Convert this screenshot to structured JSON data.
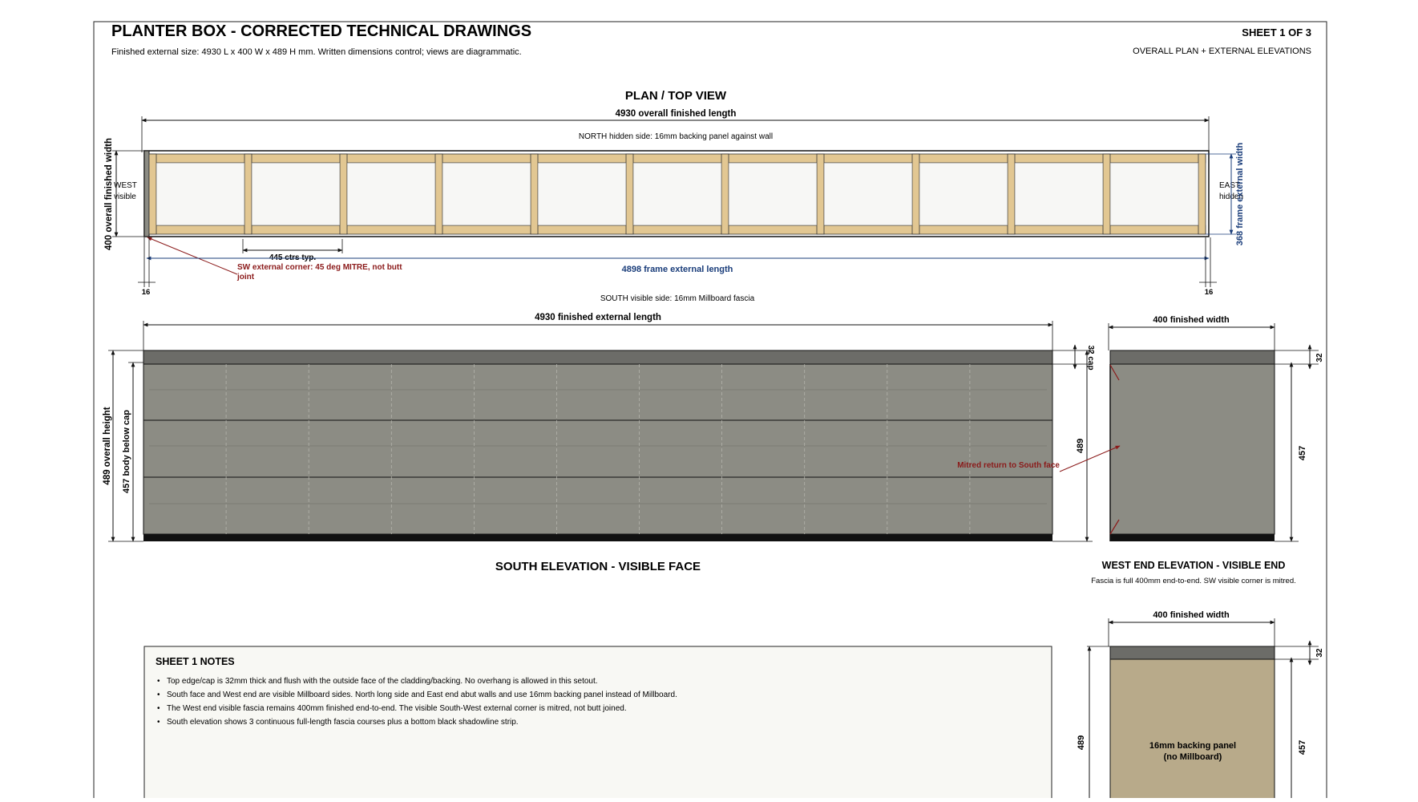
{
  "header": {
    "title": "PLANTER BOX - CORRECTED TECHNICAL DRAWINGS",
    "subtitle": "Finished external size: 4930 L x 400 W x 489 H mm. Written dimensions control; views are diagrammatic.",
    "sheet": "SHEET 1 OF 3",
    "sheet_desc": "OVERALL PLAN + EXTERNAL ELEVATIONS"
  },
  "plan": {
    "title": "PLAN / TOP VIEW",
    "overall_length": "4930 overall finished length",
    "north_note": "NORTH hidden side: 16mm backing panel against wall",
    "south_note": "SOUTH visible side: 16mm Millboard fascia",
    "west_label_1": "WEST",
    "west_label_2": "visible",
    "east_label_1": "EAST",
    "east_label_2": "hidden",
    "overall_width": "400 overall finished width",
    "frame_width": "368 frame external width",
    "spacing": "445 ctrs typ.",
    "frame_length": "4898 frame external length",
    "end_left": "16",
    "end_right": "16",
    "corner_note_1": "SW external corner: 45 deg MITRE, not butt",
    "corner_note_2": "joint",
    "bay_count": 11
  },
  "south": {
    "title": "SOUTH ELEVATION - VISIBLE FACE",
    "length": "4930 finished external length",
    "overall_height": "489 overall height",
    "body_height": "457 body below cap",
    "cap": "32 cap",
    "height": "489",
    "mitre_note": "Mitred return to South face"
  },
  "west": {
    "title": "WEST END ELEVATION - VISIBLE END",
    "note": "Fascia is full 400mm end-to-end. SW visible corner is mitred.",
    "width": "400 finished width",
    "cap": "32",
    "body": "457"
  },
  "east": {
    "width": "400 finished width",
    "cap": "32",
    "height": "489",
    "body": "457",
    "panel_1": "16mm backing panel",
    "panel_2": "(no Millboard)"
  },
  "notes": {
    "title": "SHEET 1 NOTES",
    "items": [
      "Top edge/cap is 32mm thick and flush with the outside face of the cladding/backing. No overhang is allowed in this setout.",
      "South face and West end are visible Millboard sides. North long side and East end abut walls and use 16mm backing panel instead of Millboard.",
      "The West end visible fascia remains 400mm finished end-to-end. The visible South-West external corner is mitred, not butt joined.",
      "South elevation shows 3 continuous full-length fascia courses plus a bottom black shadowline strip."
    ]
  },
  "colors": {
    "timber": "#e2c792",
    "fascia": "#8c8c84",
    "cap": "#6c6c68",
    "backing": "#b8aa8a",
    "shadow": "#111111",
    "dim_blue": "#1a3d7a",
    "note_red": "#8b1a1a",
    "notes_bg": "#f8f8f4"
  }
}
